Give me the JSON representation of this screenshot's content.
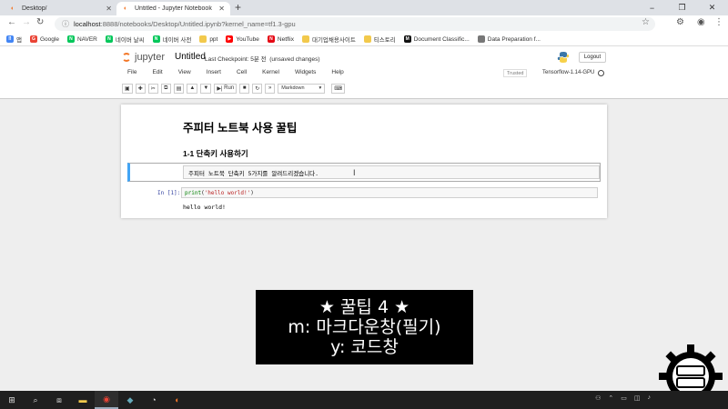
{
  "browser": {
    "tabs": [
      {
        "title": "Desktop/",
        "active": false
      },
      {
        "title": "Untitled - Jupyter Notebook",
        "active": true
      }
    ],
    "new_tab": "+",
    "window_controls": [
      "−",
      "❐",
      "✕"
    ],
    "url_host": "localhost",
    "url_rest": ":8888/notebooks/Desktop/Untitled.ipynb?kernel_name=tf1.3-gpu",
    "bookmarks": [
      {
        "label": "앱",
        "icon": "apps-grid-icon",
        "color": "#4285f4"
      },
      {
        "label": "Google",
        "icon": "google-icon",
        "color": "#ea4335"
      },
      {
        "label": "NAVER",
        "icon": "naver-icon",
        "color": "#03c75a"
      },
      {
        "label": "네이버 날씨",
        "icon": "naver-icon",
        "color": "#03c75a"
      },
      {
        "label": "네이버 사전",
        "icon": "naver-icon",
        "color": "#03c75a"
      },
      {
        "label": "ppt",
        "icon": "folder-icon",
        "color": "#f2c94c"
      },
      {
        "label": "YouTube",
        "icon": "youtube-icon",
        "color": "#ff0000"
      },
      {
        "label": "Netflix",
        "icon": "netflix-icon",
        "color": "#e50914"
      },
      {
        "label": "대기업채용사이트",
        "icon": "folder-icon",
        "color": "#f2c94c"
      },
      {
        "label": "티스토리",
        "icon": "folder-icon",
        "color": "#f2c94c"
      },
      {
        "label": "Document Classific...",
        "icon": "medium-icon",
        "color": "#111111"
      },
      {
        "label": "Data Preparation f...",
        "icon": "site-icon",
        "color": "#777777"
      }
    ]
  },
  "jupyter": {
    "logo_text": "jupyter",
    "notebook_name": "Untitled",
    "checkpoint": "Last Checkpoint: 5분 전",
    "unsaved": "(unsaved changes)",
    "logout": "Logout",
    "menu": [
      "File",
      "Edit",
      "View",
      "Insert",
      "Cell",
      "Kernel",
      "Widgets",
      "Help"
    ],
    "trusted": "Trusted",
    "kernel": "Tensorflow-1.14-GPU",
    "run_label": "Run",
    "cell_type": "Markdown"
  },
  "notebook": {
    "title": "주피터 노트북 사용 꿀팁",
    "subtitle": "1-1 단축키 사용하기",
    "markdown_cell": "주피터 노트북 단축키 5가지를 알려드리겠습니다.",
    "code_prompt": "In [1]:",
    "code_fn": "print",
    "code_str": "'hello world!'",
    "output": "hello world!"
  },
  "caption": {
    "line1": "★ 꿀팁 4 ★",
    "line2": "m: 마크다운창(필기)",
    "line3": "y: 코드창"
  },
  "colors": {
    "accent_blue": "#42a5f5",
    "jupyter_orange": "#f37626",
    "prompt_blue": "#303f9f"
  }
}
